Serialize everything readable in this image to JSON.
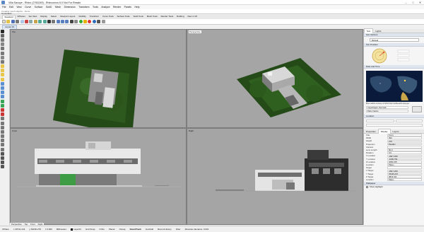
{
  "window": {
    "title": "Villa Savoye - Rhino (2760249) - Rhinoceros 6.0 Not For Resale",
    "controls": [
      "–",
      "□",
      "✕"
    ]
  },
  "menu": [
    "File",
    "Edit",
    "View",
    "Curve",
    "Surface",
    "SubD",
    "Mesh",
    "Dimension",
    "Transform",
    "Tools",
    "Analyze",
    "Render",
    "Panels",
    "Help"
  ],
  "command": {
    "history": "Creating mesh objects... Done.",
    "prompt": "Command:"
  },
  "tabs": [
    "Standard",
    "CPlanes",
    "Set View",
    "Display",
    "Select",
    "Viewport Layout",
    "Visibility",
    "Transform",
    "Curve Tools",
    "Surface Tools",
    "Solid Tools",
    "Mesh Tools",
    "Render Tools",
    "Drafting",
    "New in V6"
  ],
  "active_tab": "Standard",
  "viewport_strip_tab": "Layout #1",
  "viewports": {
    "top": "Top",
    "perspective": "Perspective",
    "front": "Front",
    "right": "Right"
  },
  "panel": {
    "tabs": [
      "Sun",
      "Lights"
    ],
    "sections": {
      "sun_options": "Sun Options",
      "manual": "Manual",
      "sun_position": "Sun Position",
      "date_time": "Date and Time",
      "location": "Location",
      "manual_control": "Manual control"
    },
    "map_caption": "Blue marble courtesy of NASA http://visibleearth.nasa.gov",
    "location_values": [
      "Copenhagen, Denmark",
      "Paris, France"
    ],
    "properties": {
      "tabs": [
        "Properties",
        "Display",
        "Layers"
      ],
      "fields": [
        {
          "k": "Title",
          "v": "Front"
        },
        {
          "k": "Width",
          "v": "494"
        },
        {
          "k": "Height",
          "v": "278"
        },
        {
          "k": "Projection",
          "v": "Parallel"
        },
        {
          "k": "Camera",
          "v": ""
        },
        {
          "k": "Lens Length",
          "v": "50.0"
        },
        {
          "k": "Rotation",
          "v": "0.0"
        },
        {
          "k": "X Location",
          "v": "-3917.200"
        },
        {
          "k": "Y Location",
          "v": "-1000.791"
        },
        {
          "k": "Z Location",
          "v": "3250.155"
        },
        {
          "k": "Location",
          "v": "Place..."
        },
        {
          "k": "Target",
          "v": ""
        },
        {
          "k": "X Target",
          "v": "-3917.200"
        },
        {
          "k": "Y Target",
          "v": "78445.207"
        },
        {
          "k": "Z Target",
          "v": "3819.011"
        },
        {
          "k": "Location",
          "v": "Place..."
        }
      ]
    },
    "bottom": [
      "Wallpaper",
      "Show Highlight"
    ]
  },
  "viewport_bottom_tabs": [
    "Perspective",
    "Top",
    "Front",
    "Right"
  ],
  "status": {
    "cplane": "CPlane",
    "x": "x 39741.244",
    "y": "y 63182.278",
    "z": "z 0.000",
    "units": "Millimeters",
    "layer": "Layer01",
    "items": [
      "Grid Snap",
      "Ortho",
      "Planar",
      "Osnap",
      "SmartTrack",
      "Gumball",
      "Record History",
      "Filter",
      "Absolute tolerance: 0.001"
    ]
  },
  "colors": {
    "grass": "#2f5d1f",
    "grass_dark": "#1e3d12",
    "viewport_bg": "#a5a5a5",
    "accent": "#3a6fbf"
  }
}
